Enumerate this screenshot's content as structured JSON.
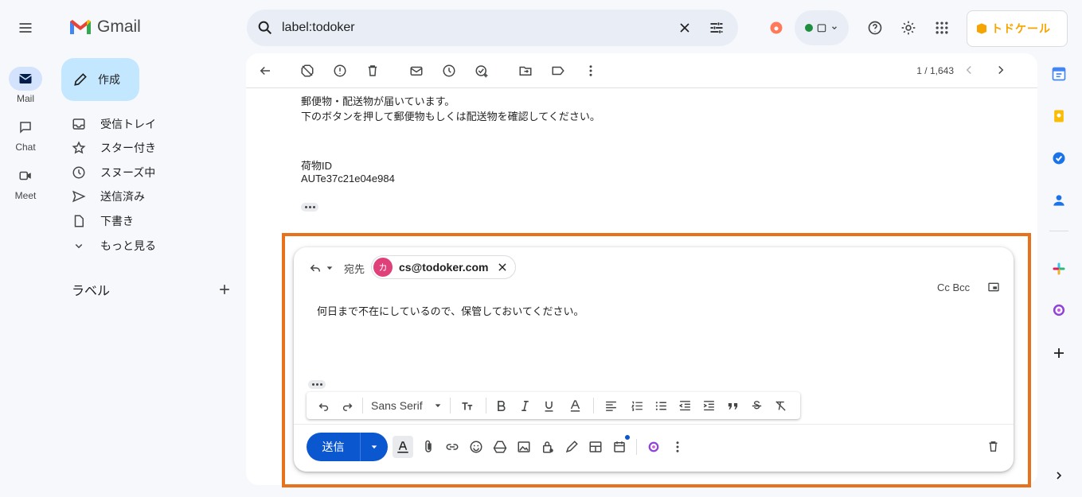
{
  "app": {
    "name": "Gmail"
  },
  "rail": [
    {
      "label": "Mail",
      "icon": "mail-icon"
    },
    {
      "label": "Chat",
      "icon": "chat-icon"
    },
    {
      "label": "Meet",
      "icon": "meet-icon"
    }
  ],
  "compose": {
    "label": "作成"
  },
  "nav": [
    {
      "label": "受信トレイ",
      "icon": "inbox-icon"
    },
    {
      "label": "スター付き",
      "icon": "star-icon"
    },
    {
      "label": "スヌーズ中",
      "icon": "clock-icon"
    },
    {
      "label": "送信済み",
      "icon": "send-icon"
    },
    {
      "label": "下書き",
      "icon": "draft-icon"
    },
    {
      "label": "もっと見る",
      "icon": "chevron-down-icon"
    }
  ],
  "labels": {
    "heading": "ラベル"
  },
  "search": {
    "query": "label:todoker"
  },
  "brand": {
    "text": "トドケール"
  },
  "pager": {
    "text": "1 / 1,643"
  },
  "message": {
    "line1": "郵便物・配送物が届いています。",
    "line2": "下のボタンを押して郵便物もしくは配送物を確認してください。",
    "id_label": "荷物ID",
    "id_value": "AUTe37c21e04e984"
  },
  "reply": {
    "to_label": "宛先",
    "avatar_initial": "カ",
    "recipient": "cs@todoker.com",
    "cc_bcc": "Cc Bcc",
    "body": "何日まで不在にしているので、保管しておいてください。",
    "font": "Sans Serif",
    "send_label": "送信"
  },
  "colors": {
    "highlight": "#e8711c",
    "send": "#0b57d0",
    "compose": "#c2e7ff"
  }
}
